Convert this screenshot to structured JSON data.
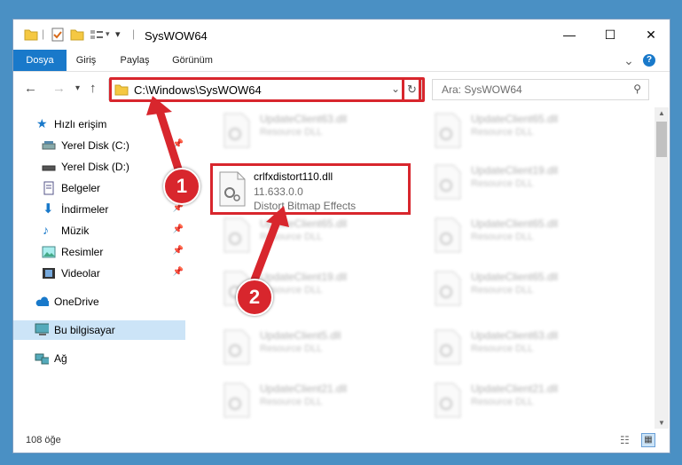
{
  "window": {
    "title": "SysWOW64",
    "minimize": "—",
    "maximize": "☐",
    "close": "✕"
  },
  "ribbon": {
    "tabs": [
      "Dosya",
      "Giriş",
      "Paylaş",
      "Görünüm"
    ],
    "expand": "⌄",
    "help": "?"
  },
  "address": {
    "path": "C:\\Windows\\SysWOW64",
    "search_placeholder": "Ara: SysWOW64"
  },
  "sidebar": {
    "quick_access": "Hızlı erişim",
    "items": [
      {
        "label": "Yerel Disk (C:)",
        "icon": "drive-icon"
      },
      {
        "label": "Yerel Disk (D:)",
        "icon": "drive-icon"
      },
      {
        "label": "Belgeler",
        "icon": "documents-icon"
      },
      {
        "label": "İndirmeler",
        "icon": "downloads-icon"
      },
      {
        "label": "Müzik",
        "icon": "music-icon"
      },
      {
        "label": "Resimler",
        "icon": "pictures-icon"
      },
      {
        "label": "Videolar",
        "icon": "videos-icon"
      }
    ],
    "onedrive": "OneDrive",
    "this_pc": "Bu bilgisayar",
    "network": "Ağ"
  },
  "files_left": [
    {
      "name": "UpdateClient63.dll",
      "type": "Resource DLL"
    },
    {
      "name": "UpdateClient65.dll",
      "type": "Resource DLL"
    },
    {
      "name": "UpdateClient19.dll",
      "type": "Resource DLL"
    },
    {
      "name": "UpdateClient5.dll",
      "type": "Resource DLL"
    },
    {
      "name": "UpdateClient21.dll",
      "type": "Resource DLL"
    }
  ],
  "files_right": [
    {
      "name": "UpdateClient65.dll",
      "type": "Resource DLL"
    },
    {
      "name": "UpdateClient19.dll",
      "type": "Resource DLL"
    },
    {
      "name": "UpdateClient65.dll",
      "type": "Resource DLL"
    },
    {
      "name": "UpdateClient65.dll",
      "type": "Resource DLL"
    },
    {
      "name": "UpdateClient63.dll",
      "type": "Resource DLL"
    },
    {
      "name": "UpdateClient21.dll",
      "type": "Resource DLL"
    }
  ],
  "highlighted_file": {
    "name": "crlfxdistort110.dll",
    "version": "11.633.0.0",
    "description": "Distort Bitmap Effects"
  },
  "status": {
    "count": "108 öğe"
  },
  "callouts": [
    "1",
    "2"
  ],
  "colors": {
    "accent": "#1979ca",
    "highlight": "#d8262d",
    "background": "#4a90c4"
  }
}
